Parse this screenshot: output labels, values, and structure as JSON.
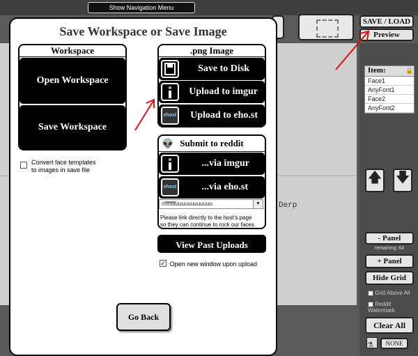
{
  "nav": {
    "show_nav_label": "Show Navigation Menu"
  },
  "top_right": {
    "save_load_label": "SAVE / LOAD",
    "preview_label": "Preview"
  },
  "items_panel": {
    "header": "Item:",
    "rows": [
      "Face1",
      "AnyFont1",
      "Face2",
      "AnyFont2"
    ]
  },
  "canvas": {
    "text": "Derp"
  },
  "side_buttons": {
    "minus_panel": "- Panel",
    "remaining": "remaining: 64",
    "plus_panel": "+ Panel",
    "hide_grid": "Hide Grid",
    "grid_above": "Grid Above All",
    "reddit_watermark": "Reddit Watermark",
    "clear_all": "Clear All",
    "none_label": "NONE"
  },
  "modal": {
    "title": "Save Workspace or Save Image",
    "workspace": {
      "header": "Workspace",
      "open_label": "Open Workspace",
      "save_label": "Save Workspace",
      "convert_label_line1": "Convert face templates",
      "convert_label_line2": "to images in save file"
    },
    "png": {
      "header": ".png Image",
      "save_disk": "Save to Disk",
      "upload_imgur": "Upload to imgur",
      "upload_ehost": "Upload to eho.st",
      "ehost_icon_text": "ehost"
    },
    "reddit": {
      "header": "Submit to reddit",
      "via_imgur": "...via imgur",
      "via_ehost": "...via eho.st",
      "subreddit_value": "r/fffffffuuuuuuuuuuuu",
      "note_line1": "Please link directly to the host's page",
      "note_line2": "so they can continue to rock our faces."
    },
    "view_past": "View Past Uploads",
    "new_window_label": "Open new window upon upload",
    "go_back": "Go Back"
  },
  "colors": {
    "annotation_arrow": "#e01010"
  }
}
